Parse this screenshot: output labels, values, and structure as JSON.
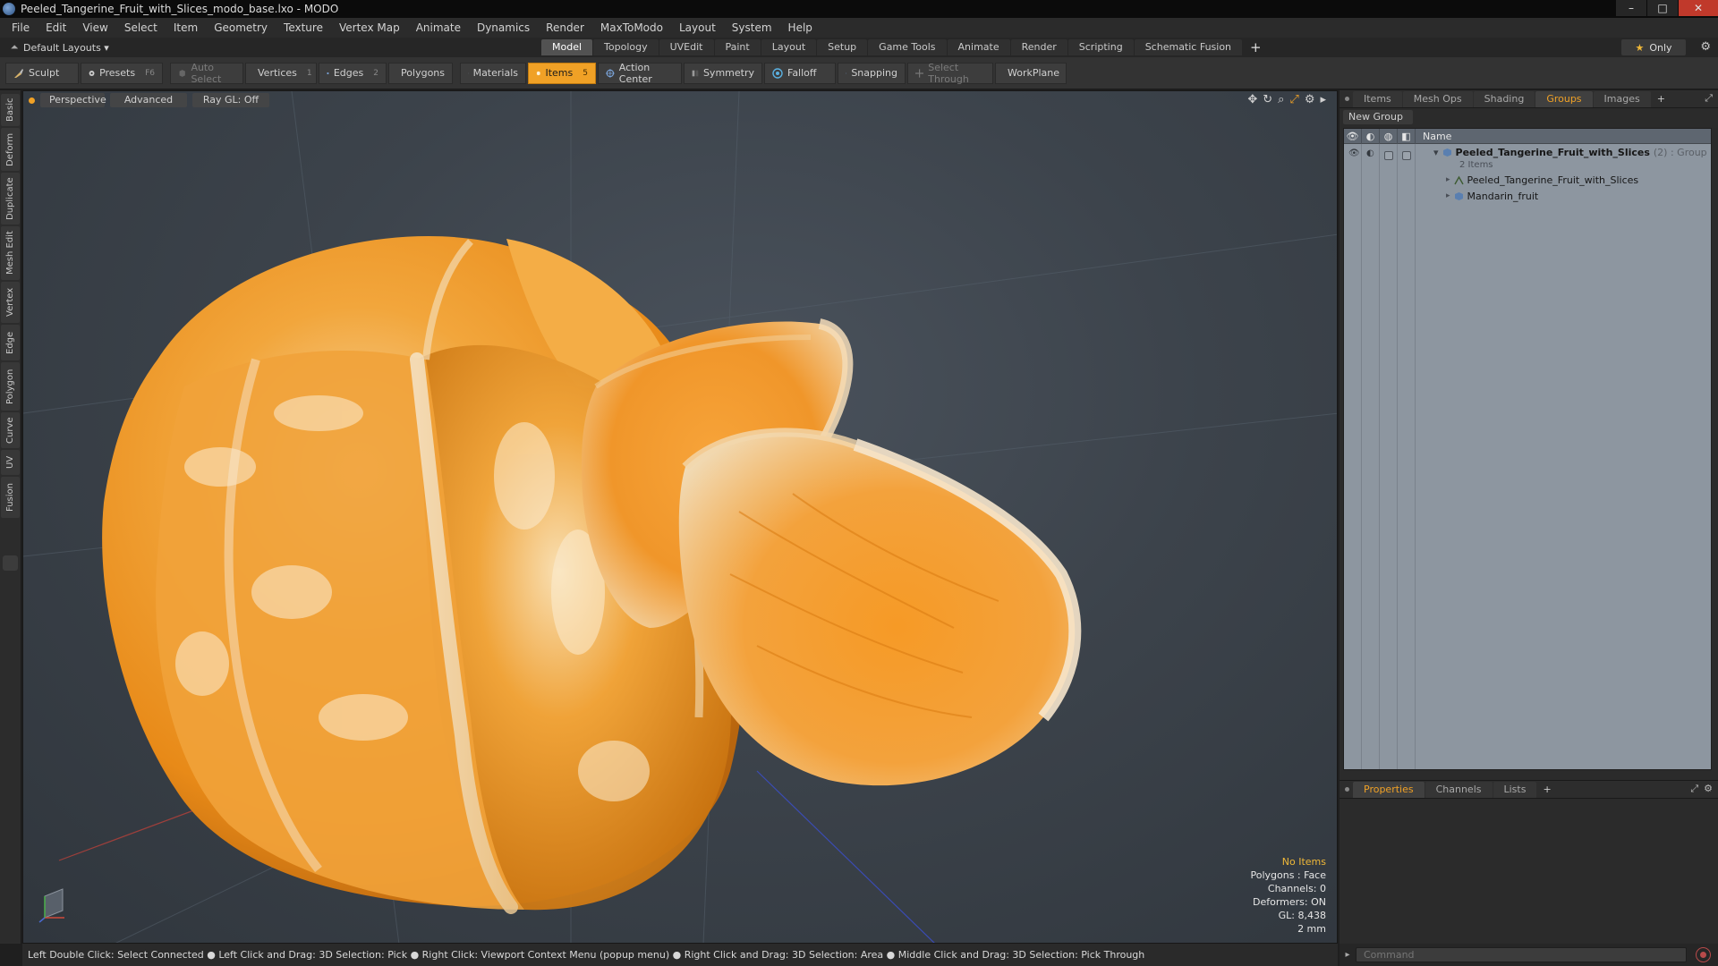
{
  "window": {
    "title": "Peeled_Tangerine_Fruit_with_Slices_modo_base.lxo - MODO",
    "controls": [
      "–",
      "□",
      "✕"
    ]
  },
  "menu": [
    "File",
    "Edit",
    "View",
    "Select",
    "Item",
    "Geometry",
    "Texture",
    "Vertex Map",
    "Animate",
    "Dynamics",
    "Render",
    "MaxToModo",
    "Layout",
    "System",
    "Help"
  ],
  "layout": {
    "selector": "Default Layouts ▾",
    "tabs": [
      "Model",
      "Topology",
      "UVEdit",
      "Paint",
      "Layout",
      "Setup",
      "Game Tools",
      "Animate",
      "Render",
      "Scripting",
      "Schematic Fusion"
    ],
    "active_tab": "Model",
    "add_tab": "+",
    "only_label": "Only"
  },
  "toolbar": {
    "sculpt": "Sculpt",
    "presets": "Presets",
    "presets_key": "F6",
    "auto_select": "Auto Select",
    "vertices": "Vertices",
    "vertices_count": "1",
    "edges": "Edges",
    "edges_count": "2",
    "polygons": "Polygons",
    "materials": "Materials",
    "items": "Items",
    "items_count": "5",
    "action_center": "Action Center",
    "symmetry": "Symmetry",
    "falloff": "Falloff",
    "snapping": "Snapping",
    "select_through": "Select Through",
    "workplane": "WorkPlane"
  },
  "left_tabs": [
    "Basic",
    "Deform",
    "Duplicate",
    "Mesh Edit",
    "Vertex",
    "Edge",
    "Polygon",
    "Curve",
    "UV",
    "Fusion"
  ],
  "viewport": {
    "view_mode": "Perspective",
    "advanced": "Advanced",
    "raygl": "Ray GL: Off",
    "info": {
      "items": "No Items",
      "polygons": "Polygons : Face",
      "channels": "Channels: 0",
      "deformers": "Deformers: ON",
      "gl": "GL: 8,438",
      "unit": "2 mm"
    }
  },
  "status_bar": "Left Double Click: Select Connected ● Left Click and Drag: 3D Selection: Pick ● Right Click: Viewport Context Menu (popup menu) ● Right Click and Drag: 3D Selection: Area ● Middle Click and Drag: 3D Selection: Pick Through",
  "right_panel": {
    "tabs": [
      "Items",
      "Mesh Ops",
      "Shading",
      "Groups",
      "Images"
    ],
    "active_tab": "Groups",
    "add_tab": "+",
    "new_group": "New Group",
    "column_name": "Name",
    "group": {
      "name": "Peeled_Tangerine_Fruit_with_Slices",
      "suffix": "(2) : Group",
      "count": "2 Items",
      "children": [
        "Peeled_Tangerine_Fruit_with_Slices",
        "Mandarin_fruit"
      ]
    },
    "bottom_tabs": [
      "Properties",
      "Channels",
      "Lists"
    ],
    "bottom_active": "Properties",
    "command_placeholder": "Command"
  },
  "colors": {
    "accent": "#f0a126",
    "viewport_bg": "#3c434b",
    "list_bg": "#8d96a0"
  }
}
